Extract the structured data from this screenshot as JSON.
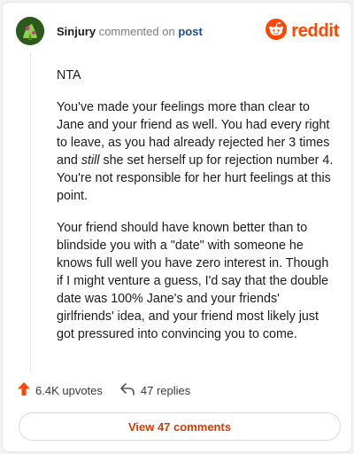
{
  "comment": {
    "username": "Sinjury",
    "action_text": "commented on",
    "post_link": "post",
    "brand": "reddit",
    "paragraphs": {
      "p1": "NTA",
      "p2_before": "You've made your feelings more than clear to Jane and your friend as well. You had every right to leave, as you had already rejected her 3 times and ",
      "p2_em": "still",
      "p2_after": " she set herself up for rejection number 4. You're not responsible for her hurt feelings at this point.",
      "p3": "Your friend should have known better than to blindside you with a \"date\" with someone he knows full well you have zero interest in. Though if I might venture a guess, I'd say that the double date was 100% Jane's and your friends' girlfriends' idea, and your friend most likely just got pressured into convincing you to come."
    }
  },
  "actions": {
    "upvotes_label": "6.4K upvotes",
    "replies_label": "47 replies",
    "view_comments_label": "View 47 comments"
  },
  "icons": {
    "avatar": "user-avatar",
    "logo": "reddit-alien-icon",
    "upvote": "upvote-arrow-icon",
    "reply": "reply-arrow-icon"
  },
  "colors": {
    "brand_orange": "#ff4500",
    "link_blue": "#1a4d8f",
    "button_text": "#d93a00"
  }
}
